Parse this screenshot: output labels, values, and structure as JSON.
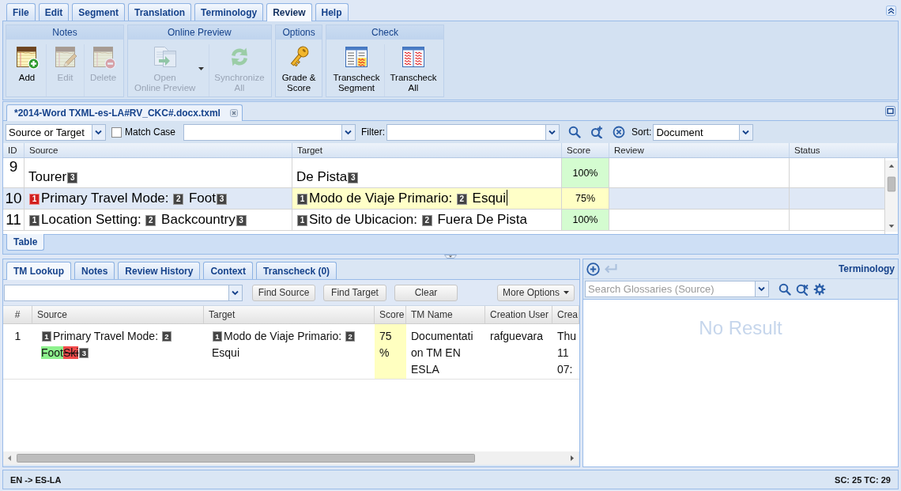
{
  "menu_tabs": [
    {
      "label": "File",
      "selected": false
    },
    {
      "label": "Edit",
      "selected": false
    },
    {
      "label": "Segment",
      "selected": false
    },
    {
      "label": "Translation",
      "selected": false
    },
    {
      "label": "Terminology",
      "selected": false
    },
    {
      "label": "Review",
      "selected": true
    },
    {
      "label": "Help",
      "selected": false
    }
  ],
  "ribbon": [
    {
      "title": "Notes",
      "buttons": [
        {
          "kind": "note-add",
          "label": "Add",
          "disabled": false,
          "dropdown": false
        },
        {
          "kind": "note-edit",
          "label": "Edit",
          "disabled": true,
          "dropdown": false
        },
        {
          "kind": "note-delete",
          "label": "Delete",
          "disabled": true,
          "dropdown": false
        }
      ]
    },
    {
      "title": "Online Preview",
      "buttons": [
        {
          "kind": "preview",
          "label": "Open\nOnline Preview",
          "disabled": true,
          "dropdown": true
        },
        {
          "kind": "sync",
          "label": "Synchronize\nAll",
          "disabled": true,
          "dropdown": false
        }
      ]
    },
    {
      "title": "Options",
      "buttons": [
        {
          "kind": "key",
          "label": "Grade &\nScore",
          "disabled": false,
          "dropdown": false
        }
      ]
    },
    {
      "title": "Check",
      "buttons": [
        {
          "kind": "transcheck-segment",
          "label": "Transcheck\nSegment",
          "disabled": false,
          "dropdown": false
        },
        {
          "kind": "transcheck-all",
          "label": "Transcheck\nAll",
          "disabled": false,
          "dropdown": false
        }
      ]
    }
  ],
  "document": {
    "tab": "*2014-Word TXML-es-LA#RV_CKC#.docx.txml",
    "filter_bar": {
      "scope": "Source or Target",
      "match_case": {
        "label": "Match Case",
        "checked": false
      },
      "filter_label": "Filter:",
      "sort_label": "Sort:",
      "sort": "Document"
    },
    "columns": [
      "ID",
      "Source",
      "Target",
      "Score",
      "Review",
      "Status"
    ],
    "rows": [
      {
        "id": "9",
        "selected": false,
        "editing": false,
        "source": [
          {
            "kind": "text",
            "text": "Tourer"
          },
          {
            "kind": "tag",
            "text": "3",
            "error": false
          }
        ],
        "target": [
          {
            "kind": "text",
            "text": "De Pista"
          },
          {
            "kind": "tag",
            "text": "3",
            "error": false
          }
        ],
        "score": {
          "text": "100%",
          "color": "#d4fcd0"
        }
      },
      {
        "id": "10",
        "selected": true,
        "editing": true,
        "source": [
          {
            "kind": "tag",
            "text": "1",
            "error": true
          },
          {
            "kind": "text",
            "text": "Primary Travel Mode: "
          },
          {
            "kind": "tag",
            "text": "2",
            "error": false
          },
          {
            "kind": "text",
            "text": " Foot"
          },
          {
            "kind": "tag",
            "text": "3",
            "error": false
          }
        ],
        "target": [
          {
            "kind": "tag",
            "text": "1",
            "error": false
          },
          {
            "kind": "text",
            "text": "Modo de Viaje Primario: "
          },
          {
            "kind": "tag",
            "text": "2",
            "error": false
          },
          {
            "kind": "text",
            "text": " Esqui"
          }
        ],
        "score": {
          "text": "75%",
          "color": "#ffffc4"
        }
      },
      {
        "id": "11",
        "selected": false,
        "editing": false,
        "source": [
          {
            "kind": "tag",
            "text": "1",
            "error": false
          },
          {
            "kind": "text",
            "text": "Location Setting: "
          },
          {
            "kind": "tag",
            "text": "2",
            "error": false
          },
          {
            "kind": "text",
            "text": " Backcountry"
          },
          {
            "kind": "tag",
            "text": "3",
            "error": false
          }
        ],
        "target": [
          {
            "kind": "tag",
            "text": "1",
            "error": false
          },
          {
            "kind": "text",
            "text": "Sito de Ubicacion: "
          },
          {
            "kind": "tag",
            "text": "2",
            "error": false
          },
          {
            "kind": "text",
            "text": " Fuera De Pista"
          }
        ],
        "score": {
          "text": "100%",
          "color": "#d4fcd0"
        }
      }
    ],
    "view_tabs": [
      {
        "label": "Table",
        "selected": true
      }
    ]
  },
  "tm_lookup": {
    "tabs": [
      {
        "label": "TM Lookup",
        "selected": true
      },
      {
        "label": "Notes",
        "selected": false
      },
      {
        "label": "Review History",
        "selected": false
      },
      {
        "label": "Context",
        "selected": false
      },
      {
        "label": "Transcheck (0)",
        "selected": false
      }
    ],
    "buttons": [
      "Find Source",
      "Find Target",
      "Clear"
    ],
    "more_options": "More Options",
    "columns": [
      "#",
      "Source",
      "Target",
      "Score",
      "TM Name",
      "Creation User",
      "Crea"
    ],
    "rows": [
      {
        "number": "1",
        "source": [
          {
            "kind": "tag",
            "text": "1",
            "error": false
          },
          {
            "kind": "text",
            "text": "Primary Travel Mode: "
          },
          {
            "kind": "tag",
            "text": "2",
            "error": false
          },
          {
            "kind": "insert",
            "text": "Foot"
          },
          {
            "kind": "delete",
            "text": "Ski"
          },
          {
            "kind": "tag",
            "text": "3",
            "error": false
          }
        ],
        "target": [
          {
            "kind": "tag",
            "text": "1",
            "error": false
          },
          {
            "kind": "text",
            "text": "Modo de Viaje Primario: "
          },
          {
            "kind": "tag",
            "text": "2",
            "error": false
          },
          {
            "kind": "text",
            "text": " Esqui"
          }
        ],
        "score": {
          "text": "75 %",
          "color": "#ffffc0"
        },
        "tm_name": "Documentation TM EN ESLA",
        "creation_user": "rafguevara",
        "column_7": "Thu\n11\n07:"
      }
    ]
  },
  "terminology": {
    "title": "Terminology",
    "tools": [
      {
        "kind": "add",
        "disabled": false
      },
      {
        "kind": "insert",
        "disabled": true
      }
    ],
    "search_placeholder": "Search Glossaries (Source)",
    "empty_text": "No Result"
  },
  "status_bar": {
    "language_pair": "EN -> ES-LA",
    "counts": "SC: 25 TC: 29"
  }
}
